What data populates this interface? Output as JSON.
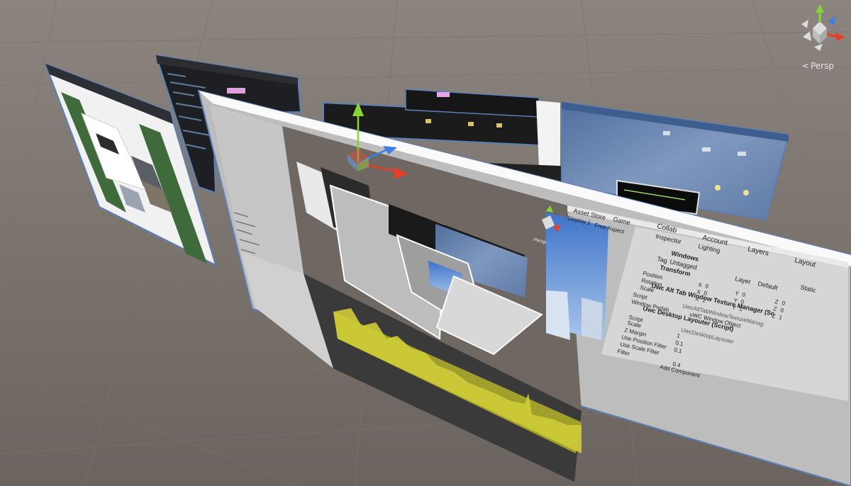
{
  "scene": {
    "view_mode": "Persp",
    "view_mode_icon": "back-arrow-icon",
    "gizmo_icon": "orientation-gizmo-icon"
  },
  "unity_window": {
    "tabs": {
      "asset_store": "Asset Store",
      "game": "Game"
    },
    "game_toolbar": {
      "display": "Display 1",
      "aspect": "Free Aspect"
    },
    "inner_view_mode": "Persp",
    "collab": "Collab",
    "account": "Account",
    "layers": "Layers",
    "layout": "Layout",
    "inspector_tab": "Inspector",
    "lighting_tab": "Lighting",
    "object_name": "Windows",
    "tag_label": "Tag",
    "tag_value": "Untagged",
    "layer_label": "Layer",
    "layer_value": "Default",
    "static_label": "Static",
    "transform": {
      "title": "Transform",
      "position_label": "Position",
      "rotation_label": "Rotation",
      "scale_label": "Scale",
      "x_label": "X",
      "y_label": "Y",
      "z_label": "Z",
      "position": [
        "0",
        "0",
        "0"
      ],
      "rotation": [
        "0",
        "0",
        "0"
      ],
      "scale": [
        "1",
        "1",
        "1"
      ]
    },
    "components": [
      {
        "title": "Uwc Alt Tab Window Texture Manager (Sc",
        "fields": [
          {
            "label": "Script",
            "value": "UwcAltTabWindowTextureManag"
          },
          {
            "label": "Window Prefab",
            "value": "uWC Window Object"
          }
        ]
      },
      {
        "title": "Uwc Desktop Layouter (Script)",
        "fields": [
          {
            "label": "Script",
            "value": "UwcDesktopLayouter"
          },
          {
            "label": "Scale",
            "value": "1"
          },
          {
            "label": "Z Margin",
            "value": "0.1"
          },
          {
            "label": "Use Position Filter",
            "value": "0.1"
          },
          {
            "label": "Use Scale Filter",
            "value": ""
          },
          {
            "label": "Filter",
            "value": "0.4"
          }
        ]
      }
    ],
    "add_component": "Add Component"
  },
  "colors": {
    "ground": "#6b645f",
    "sky": "#8a817b",
    "axis_x": "#e83d27",
    "axis_y": "#87d432",
    "axis_z": "#3d7ee8",
    "unity_panel": "#c8c8c8",
    "profiler_bars": "#b5b32c"
  }
}
